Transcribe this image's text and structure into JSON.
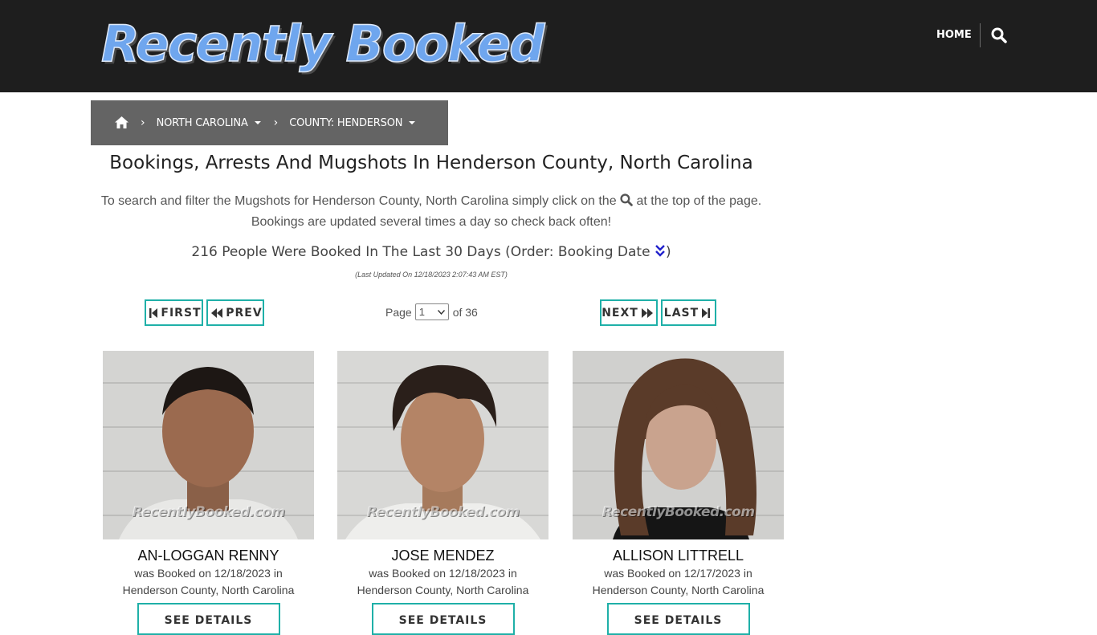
{
  "header": {
    "logo_text": "Recently Booked",
    "nav_home": "HOME"
  },
  "breadcrumb": {
    "state": "NORTH CAROLINA",
    "county": "COUNTY: HENDERSON"
  },
  "page": {
    "title": "Bookings, Arrests And Mugshots In Henderson County, North Carolina",
    "desc_before_icon": "To search and filter the Mugshots for Henderson County, North Carolina simply click on the",
    "desc_after_icon": "at the top of the page. Bookings are updated several times a day so check back often!",
    "count_text": "216 People Were Booked In The Last 30 Days (Order: Booking Date",
    "count_close": ")",
    "last_updated": "(Last Updated On 12/18/2023 2:07:43 AM EST)"
  },
  "pagination": {
    "first": "FIRST",
    "prev": "PREV",
    "next": "NEXT",
    "last": "LAST",
    "page_label": "Page",
    "current_page": "1",
    "of_label": "of 36"
  },
  "bookings": [
    {
      "name": "AN-LOGGAN RENNY",
      "booked_line": "was Booked on 12/18/2023 in",
      "location": "Henderson County, North Carolina",
      "button": "SEE DETAILS",
      "watermark": "RecentlyBooked.com"
    },
    {
      "name": "JOSE MENDEZ",
      "booked_line": "was Booked on 12/18/2023 in",
      "location": "Henderson County, North Carolina",
      "button": "SEE DETAILS",
      "watermark": "RecentlyBooked.com"
    },
    {
      "name": "ALLISON LITTRELL",
      "booked_line": "was Booked on 12/17/2023 in",
      "location": "Henderson County, North Carolina",
      "button": "SEE DETAILS",
      "watermark": "RecentlyBooked.com"
    }
  ],
  "colors": {
    "header_bg": "#1e1e1e",
    "breadcrumb_bg": "#646464",
    "accent_teal": "#1fb0a8",
    "logo_blue": "#6fa6ee"
  }
}
